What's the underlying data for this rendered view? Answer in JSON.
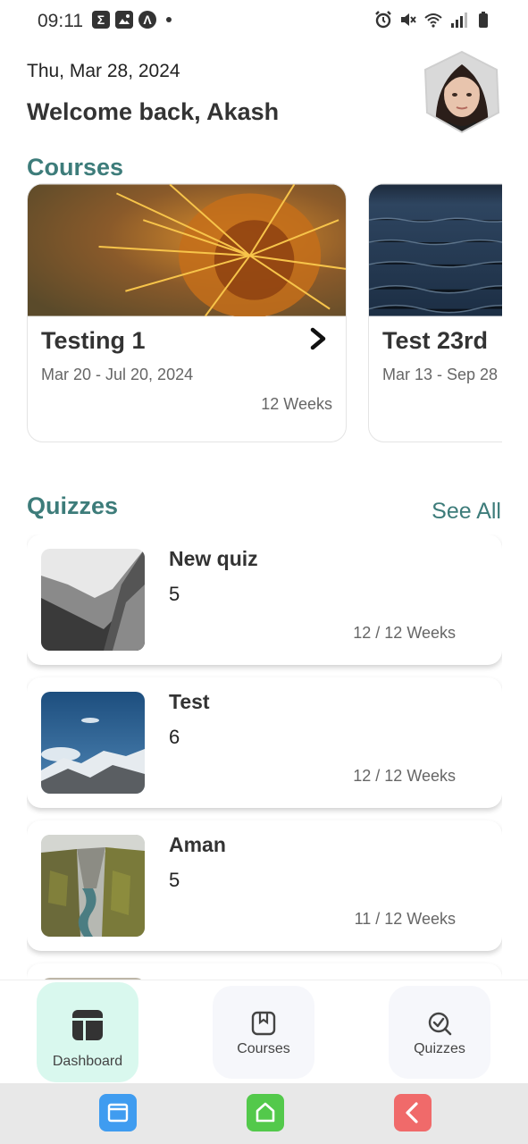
{
  "status_bar": {
    "time": "09:11",
    "left_icons": [
      "sigma-icon",
      "image-icon",
      "lambda-icon",
      "dot-icon"
    ],
    "right_icons": [
      "alarm-icon",
      "mute-icon",
      "wifi-icon",
      "signal-icon",
      "battery-icon"
    ]
  },
  "header": {
    "date": "Thu, Mar 28, 2024",
    "welcome": "Welcome back, Akash"
  },
  "courses": {
    "title": "Courses",
    "items": [
      {
        "title": "Testing 1",
        "dates": "Mar 20 - Jul 20, 2024",
        "weeks": "12 Weeks"
      },
      {
        "title": "Test 23rd",
        "dates": "Mar 13 - Sep 28",
        "weeks": ""
      }
    ]
  },
  "quizzes": {
    "title": "Quizzes",
    "see_all": "See All",
    "items": [
      {
        "title": "New quiz",
        "count": "5",
        "weeks": "12 / 12 Weeks"
      },
      {
        "title": "Test",
        "count": "6",
        "weeks": "12 / 12 Weeks"
      },
      {
        "title": "Aman",
        "count": "5",
        "weeks": "11 / 12 Weeks"
      }
    ]
  },
  "bottom_nav": {
    "items": [
      {
        "label": "Dashboard",
        "icon": "dashboard-icon",
        "active": true
      },
      {
        "label": "Courses",
        "icon": "courses-icon",
        "active": false
      },
      {
        "label": "Quizzes",
        "icon": "quizzes-icon",
        "active": false
      }
    ]
  },
  "colors": {
    "accent": "#3d7c7a",
    "active_nav_bg": "#d9f8ee",
    "inactive_nav_bg": "#f6f7fb"
  }
}
